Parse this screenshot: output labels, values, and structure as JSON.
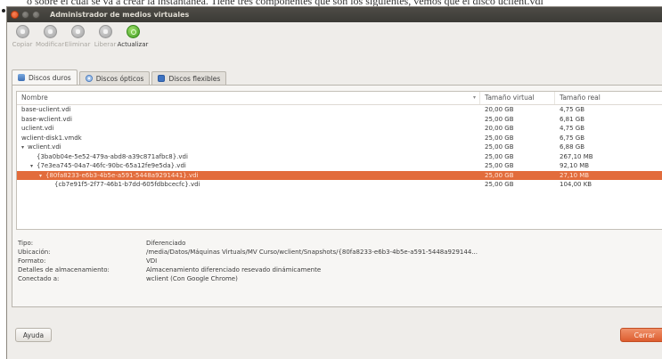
{
  "background_text": "o sobre el cual se va a crear la instantanea. Tiene tres componentes que son los siguientes, vemos que el disco uclient.vdi",
  "window": {
    "title": "Administrador de medios virtuales"
  },
  "toolbar": {
    "items": [
      {
        "label": "Copiar",
        "icon": "copy-disk-icon"
      },
      {
        "label": "Modificar",
        "icon": "modify-disk-icon"
      },
      {
        "label": "Eliminar",
        "icon": "remove-disk-icon"
      },
      {
        "label": "Liberar",
        "icon": "release-disk-icon"
      },
      {
        "label": "Actualizar",
        "icon": "refresh-icon"
      }
    ]
  },
  "tabs": [
    {
      "label": "Discos duros",
      "icon": "hard-disk-icon"
    },
    {
      "label": "Discos ópticos",
      "icon": "optical-disk-icon"
    },
    {
      "label": "Discos flexibles",
      "icon": "floppy-disk-icon"
    }
  ],
  "table": {
    "columns": [
      "Nombre",
      "Tamaño virtual",
      "Tamaño real"
    ],
    "rows": [
      {
        "name": "base-uclient.vdi",
        "virtual": "20,00 GB",
        "real": "4,75 GB",
        "level": 0,
        "expander": ""
      },
      {
        "name": "base-wclient.vdi",
        "virtual": "25,00 GB",
        "real": "6,81 GB",
        "level": 0,
        "expander": ""
      },
      {
        "name": "uclient.vdi",
        "virtual": "20,00 GB",
        "real": "4,75 GB",
        "level": 0,
        "expander": ""
      },
      {
        "name": "wclient-disk1.vmdk",
        "virtual": "25,00 GB",
        "real": "6,75 GB",
        "level": 0,
        "expander": ""
      },
      {
        "name": "wclient.vdi",
        "virtual": "25,00 GB",
        "real": "6,88 GB",
        "level": 0,
        "expander": "▾"
      },
      {
        "name": "{3ba0b04e-5e52-479a-abd8-a39c871afbc8}.vdi",
        "virtual": "25,00 GB",
        "real": "267,10 MB",
        "level": 1,
        "expander": ""
      },
      {
        "name": "{7e3ea745-04a7-46fc-90bc-65a12fe9e5da}.vdi",
        "virtual": "25,00 GB",
        "real": "92,10 MB",
        "level": 1,
        "expander": "▾"
      },
      {
        "name": "{80fa8233-e6b3-4b5e-a591-5448a9291441}.vdi",
        "virtual": "25,00 GB",
        "real": "27,10 MB",
        "level": 2,
        "expander": "▾",
        "selected": true
      },
      {
        "name": "{cb7e91f5-2f77-46b1-b7dd-605fdbbcecfc}.vdi",
        "virtual": "25,00 GB",
        "real": "104,00 KB",
        "level": 3,
        "expander": ""
      }
    ]
  },
  "details": [
    {
      "label": "Tipo:",
      "value": "Diferenciado"
    },
    {
      "label": "Ubicación:",
      "value": "/media/Datos/Máquinas Virtuals/MV Curso/wclient/Snapshots/{80fa8233-e6b3-4b5e-a591-5448a929144..."
    },
    {
      "label": "Formato:",
      "value": "VDI"
    },
    {
      "label": "Detalles de almacenamiento:",
      "value": "Almacenamiento diferenciado resevado dinámicamente"
    },
    {
      "label": "Conectado a:",
      "value": "wclient (Con Google Chrome)"
    }
  ],
  "buttons": {
    "help": "Ayuda",
    "close": "Cerrar"
  }
}
